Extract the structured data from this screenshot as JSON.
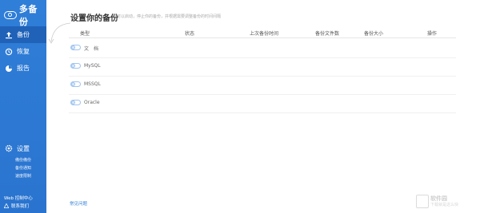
{
  "app": {
    "name": "多备份"
  },
  "nav": [
    {
      "label": "备份",
      "icon": "upload-icon",
      "active": true
    },
    {
      "label": "恢复",
      "icon": "restore-icon",
      "active": false
    },
    {
      "label": "报告",
      "icon": "report-icon",
      "active": false
    }
  ],
  "settings": {
    "label": "设置",
    "icon": "gear-icon",
    "items": [
      "備份備份",
      "备份通知",
      "速度限制"
    ]
  },
  "footer": {
    "web_console": "Web 控制中心",
    "contact": "联系我们",
    "faq": "常见问题"
  },
  "main": {
    "title": "设置你的备份",
    "subtitle": "你可以启动，停止你的备份，并根据需要调整备份的时间间隔",
    "columns": [
      "类型",
      "状态",
      "上次备份时间",
      "备份文件数",
      "备份大小",
      "操作"
    ],
    "rows": [
      {
        "type": "文　档"
      },
      {
        "type": "MySQL"
      },
      {
        "type": "MSSQL"
      },
      {
        "type": "Oracle"
      }
    ]
  },
  "watermark": {
    "line1": "软件园",
    "line2": "下载就是这么快"
  },
  "colors": {
    "sidebar": "#2f7ed8",
    "active": "#1f62b8",
    "accent": "#2f7ed8"
  }
}
